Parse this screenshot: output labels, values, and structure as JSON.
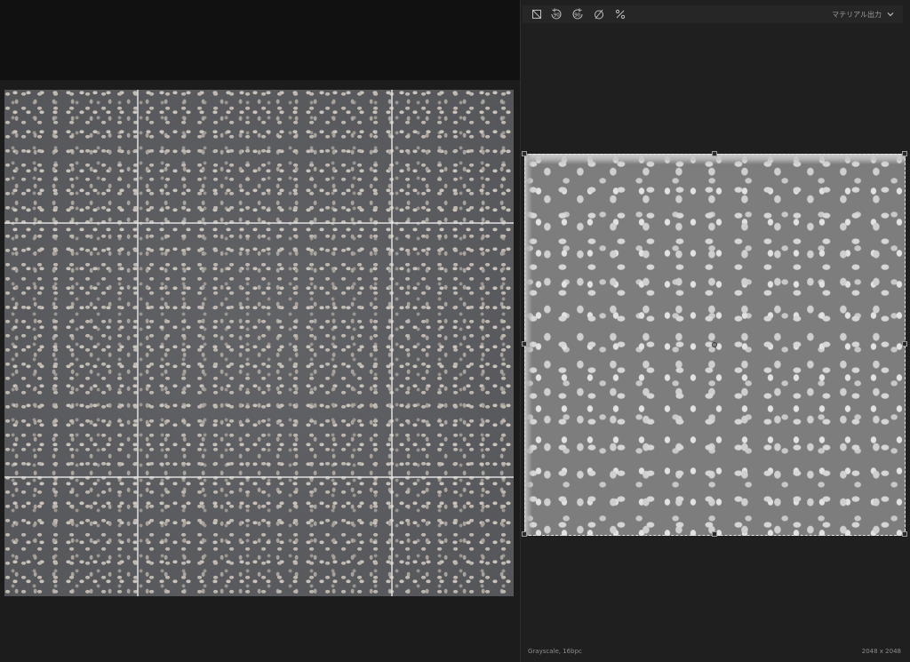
{
  "toolbar": {
    "tools": [
      {
        "name": "fit-crop-icon"
      },
      {
        "name": "rotate-ccw-90-icon",
        "label": "90"
      },
      {
        "name": "rotate-cw-90-icon",
        "label": "90"
      },
      {
        "name": "reset-rotation-icon"
      },
      {
        "name": "random-seed-icon"
      }
    ],
    "output_label": "マテリアル出力"
  },
  "status": {
    "format": "Grayscale, 16bpc",
    "resolution": "2048 x 2048"
  },
  "colors": {
    "background": "#141414",
    "panel": "#1f1f1f",
    "selection": "#e8e8e8"
  }
}
